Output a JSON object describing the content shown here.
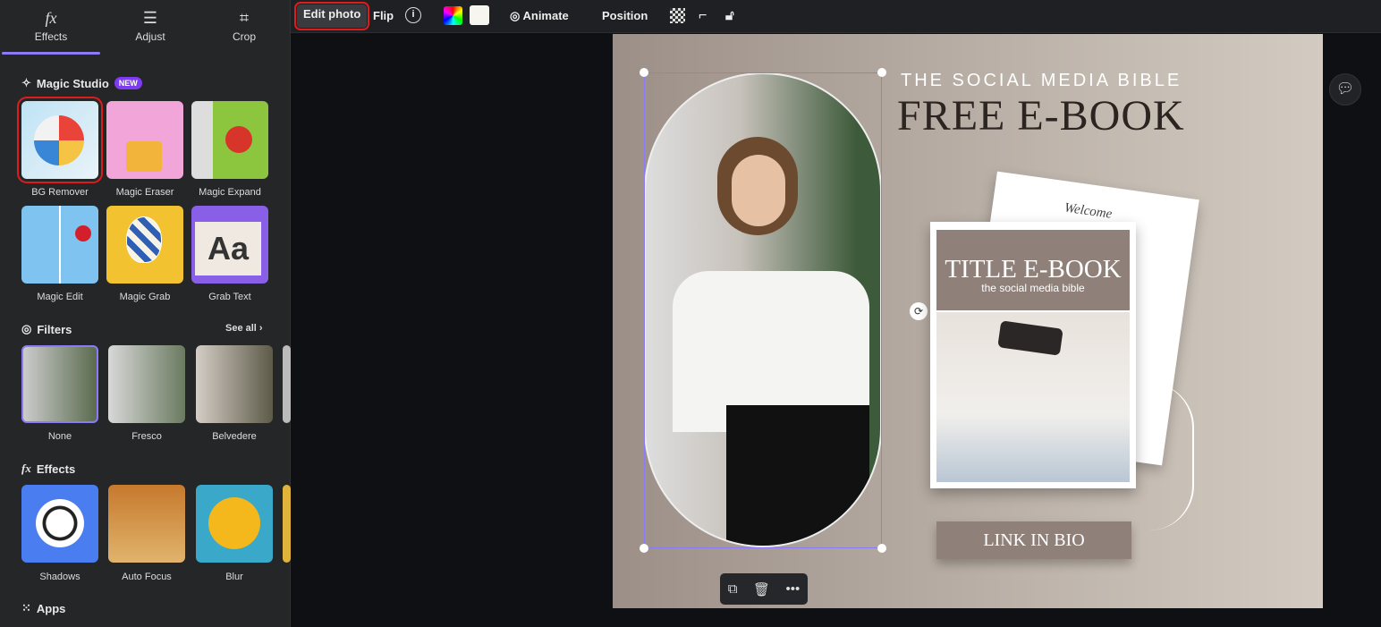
{
  "tabs": [
    {
      "label": "Effects",
      "icon": "fx-icon"
    },
    {
      "label": "Adjust",
      "icon": "sliders-icon"
    },
    {
      "label": "Crop",
      "icon": "crop-icon"
    }
  ],
  "magic_studio": {
    "title": "Magic Studio",
    "badge": "NEW",
    "tools": [
      "BG Remover",
      "Magic Eraser",
      "Magic Expand",
      "Magic Edit",
      "Magic Grab",
      "Grab Text"
    ]
  },
  "filters": {
    "title": "Filters",
    "see_all": "See all",
    "items": [
      "None",
      "Fresco",
      "Belvedere"
    ]
  },
  "effects": {
    "title": "Effects",
    "items": [
      "Shadows",
      "Auto Focus",
      "Blur"
    ]
  },
  "apps": {
    "title": "Apps"
  },
  "toolbar": {
    "edit_photo": "Edit photo",
    "flip": "Flip",
    "animate": "Animate",
    "position": "Position"
  },
  "design": {
    "kicker": "THE SOCIAL MEDIA BIBLE",
    "title": "FREE E-BOOK",
    "book_title": "TITLE E-BOOK",
    "book_sub": "the social media bible",
    "welcome": "Welcome",
    "cta": "LINK IN BIO"
  },
  "colors": {
    "accent": "#8b7cf6",
    "highlight": "#e01b1b",
    "badge": "#7d3cf1"
  }
}
